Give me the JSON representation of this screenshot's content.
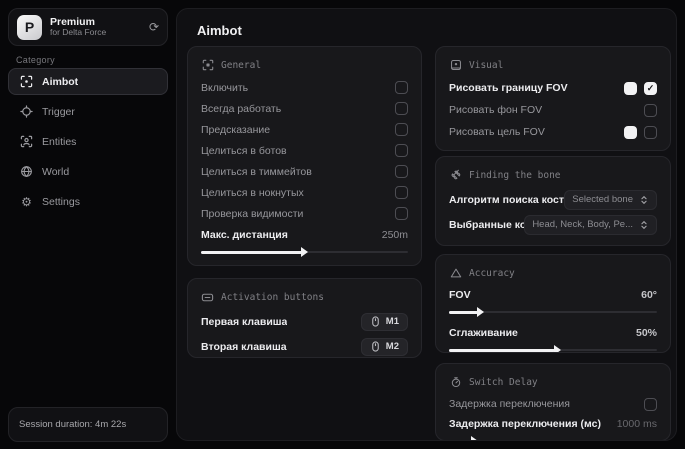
{
  "colors": {
    "accent": "#f2f2f4",
    "card_bg": "#18181b",
    "panel_bg": "#101013",
    "body_bg": "#070709"
  },
  "sidebar": {
    "brand": {
      "logo_letter": "P",
      "title": "Premium",
      "subtitle": "for Delta Force",
      "action_icon": "refresh-icon"
    },
    "category_label": "Category",
    "items": [
      {
        "label": "Aimbot",
        "icon": "crosshair-scan-icon",
        "active": true
      },
      {
        "label": "Trigger",
        "icon": "trigger-target-icon",
        "active": false
      },
      {
        "label": "Entities",
        "icon": "entities-person-icon",
        "active": false
      },
      {
        "label": "World",
        "icon": "globe-icon",
        "active": false
      },
      {
        "label": "Settings",
        "icon": "gear-icon",
        "active": false
      }
    ],
    "session": "Session duration: 4m 22s"
  },
  "header": {
    "title": "Aimbot"
  },
  "general": {
    "title": "General",
    "rows": [
      {
        "label": "Включить",
        "checked": false
      },
      {
        "label": "Всегда работать",
        "checked": false
      },
      {
        "label": "Предсказание",
        "checked": false
      },
      {
        "label": "Целиться в ботов",
        "checked": false
      },
      {
        "label": "Целиться в тиммейтов",
        "checked": false
      },
      {
        "label": "Целиться в нокнутых",
        "checked": false
      },
      {
        "label": "Проверка видимости",
        "checked": false
      }
    ],
    "distance": {
      "label": "Макс. дистанция",
      "value": "250m",
      "fill": 49
    }
  },
  "activation": {
    "title": "Activation buttons",
    "rows": [
      {
        "label": "Первая клавиша",
        "key": "M1"
      },
      {
        "label": "Вторая клавиша",
        "key": "M2"
      }
    ]
  },
  "visual": {
    "title": "Visual",
    "rows": [
      {
        "label": "Рисовать границу FOV",
        "has_swatch": true,
        "checked": true
      },
      {
        "label": "Рисовать фон FOV",
        "has_swatch": false,
        "checked": false
      },
      {
        "label": "Рисовать цель FOV",
        "has_swatch": true,
        "checked": false
      }
    ]
  },
  "bone": {
    "title": "Finding the bone",
    "rows": [
      {
        "label": "Алгоритм поиска кост",
        "value": "Selected bone"
      },
      {
        "label": "Выбранные кос",
        "value": "Head, Neck, Body, Pe..."
      }
    ]
  },
  "accuracy": {
    "title": "Accuracy",
    "rows": [
      {
        "label": "FOV",
        "value": "60°",
        "fill": 14
      },
      {
        "label": "Сглаживание",
        "value": "50%",
        "fill": 51
      }
    ]
  },
  "switch_delay": {
    "title": "Switch Delay",
    "toggle": {
      "label": "Задержка переключения",
      "checked": false
    },
    "slider": {
      "label": "Задержка переключения (мс)",
      "value": "1000 ms",
      "fill": 11
    }
  },
  "check_glyph": "✓"
}
